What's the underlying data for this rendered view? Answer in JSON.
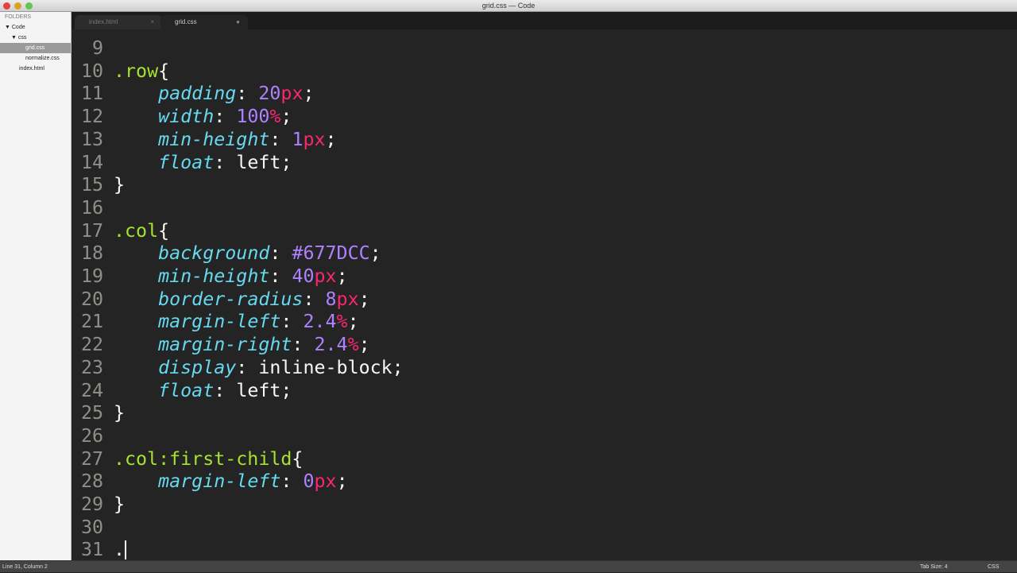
{
  "window": {
    "title": "grid.css — Code"
  },
  "sidebar": {
    "header": "FOLDERS",
    "items": [
      {
        "label": "▼ Code",
        "indent": 6
      },
      {
        "label": "▼ css",
        "indent": 14
      },
      {
        "label": "grid.css",
        "indent": 32,
        "selected": true
      },
      {
        "label": "normalize.css",
        "indent": 32
      },
      {
        "label": "index.html",
        "indent": 24
      }
    ]
  },
  "tabs": [
    {
      "label": "index.html",
      "icon": "close-icon",
      "active": false
    },
    {
      "label": "grid.css",
      "icon": "modified-dot-icon",
      "active": true
    }
  ],
  "editor": {
    "lines": [
      {
        "n": "9",
        "t": []
      },
      {
        "n": "10",
        "t": [
          [
            "sel",
            ".row"
          ],
          [
            "brace",
            "{"
          ]
        ]
      },
      {
        "n": "11",
        "t": [
          [
            "val",
            "    "
          ],
          [
            "prop",
            "padding"
          ],
          [
            "colon",
            ": "
          ],
          [
            "num",
            "20"
          ],
          [
            "unit",
            "px"
          ],
          [
            "punct",
            ";"
          ]
        ]
      },
      {
        "n": "12",
        "t": [
          [
            "val",
            "    "
          ],
          [
            "prop",
            "width"
          ],
          [
            "colon",
            ": "
          ],
          [
            "num",
            "100"
          ],
          [
            "unit",
            "%"
          ],
          [
            "punct",
            ";"
          ]
        ]
      },
      {
        "n": "13",
        "t": [
          [
            "val",
            "    "
          ],
          [
            "prop",
            "min-height"
          ],
          [
            "colon",
            ": "
          ],
          [
            "num",
            "1"
          ],
          [
            "unit",
            "px"
          ],
          [
            "punct",
            ";"
          ]
        ]
      },
      {
        "n": "14",
        "t": [
          [
            "val",
            "    "
          ],
          [
            "prop",
            "float"
          ],
          [
            "colon",
            ": "
          ],
          [
            "val",
            "left"
          ],
          [
            "punct",
            ";"
          ]
        ]
      },
      {
        "n": "15",
        "t": [
          [
            "brace",
            "}"
          ]
        ]
      },
      {
        "n": "16",
        "t": []
      },
      {
        "n": "17",
        "t": [
          [
            "sel",
            ".col"
          ],
          [
            "brace",
            "{"
          ]
        ]
      },
      {
        "n": "18",
        "t": [
          [
            "val",
            "    "
          ],
          [
            "prop",
            "background"
          ],
          [
            "colon",
            ": "
          ],
          [
            "num",
            "#677DCC"
          ],
          [
            "punct",
            ";"
          ]
        ]
      },
      {
        "n": "19",
        "t": [
          [
            "val",
            "    "
          ],
          [
            "prop",
            "min-height"
          ],
          [
            "colon",
            ": "
          ],
          [
            "num",
            "40"
          ],
          [
            "unit",
            "px"
          ],
          [
            "punct",
            ";"
          ]
        ]
      },
      {
        "n": "20",
        "t": [
          [
            "val",
            "    "
          ],
          [
            "prop",
            "border-radius"
          ],
          [
            "colon",
            ": "
          ],
          [
            "num",
            "8"
          ],
          [
            "unit",
            "px"
          ],
          [
            "punct",
            ";"
          ]
        ]
      },
      {
        "n": "21",
        "t": [
          [
            "val",
            "    "
          ],
          [
            "prop",
            "margin-left"
          ],
          [
            "colon",
            ": "
          ],
          [
            "num",
            "2.4"
          ],
          [
            "unit",
            "%"
          ],
          [
            "punct",
            ";"
          ]
        ]
      },
      {
        "n": "22",
        "t": [
          [
            "val",
            "    "
          ],
          [
            "prop",
            "margin-right"
          ],
          [
            "colon",
            ": "
          ],
          [
            "num",
            "2.4"
          ],
          [
            "unit",
            "%"
          ],
          [
            "punct",
            ";"
          ]
        ]
      },
      {
        "n": "23",
        "t": [
          [
            "val",
            "    "
          ],
          [
            "prop",
            "display"
          ],
          [
            "colon",
            ": "
          ],
          [
            "val",
            "inline-block"
          ],
          [
            "punct",
            ";"
          ]
        ]
      },
      {
        "n": "24",
        "t": [
          [
            "val",
            "    "
          ],
          [
            "prop",
            "float"
          ],
          [
            "colon",
            ": "
          ],
          [
            "val",
            "left"
          ],
          [
            "punct",
            ";"
          ]
        ]
      },
      {
        "n": "25",
        "t": [
          [
            "brace",
            "}"
          ]
        ]
      },
      {
        "n": "26",
        "t": []
      },
      {
        "n": "27",
        "t": [
          [
            "sel",
            ".col:first-child"
          ],
          [
            "brace",
            "{"
          ]
        ]
      },
      {
        "n": "28",
        "t": [
          [
            "val",
            "    "
          ],
          [
            "prop",
            "margin-left"
          ],
          [
            "colon",
            ": "
          ],
          [
            "num",
            "0"
          ],
          [
            "unit",
            "px"
          ],
          [
            "punct",
            ";"
          ]
        ]
      },
      {
        "n": "29",
        "t": [
          [
            "brace",
            "}"
          ]
        ]
      },
      {
        "n": "30",
        "t": []
      },
      {
        "n": "31",
        "t": [
          [
            "val",
            "."
          ]
        ],
        "cursor": true
      }
    ]
  },
  "status": {
    "position": "Line 31, Column 2",
    "tab_size": "Tab Size: 4",
    "syntax": "CSS"
  }
}
